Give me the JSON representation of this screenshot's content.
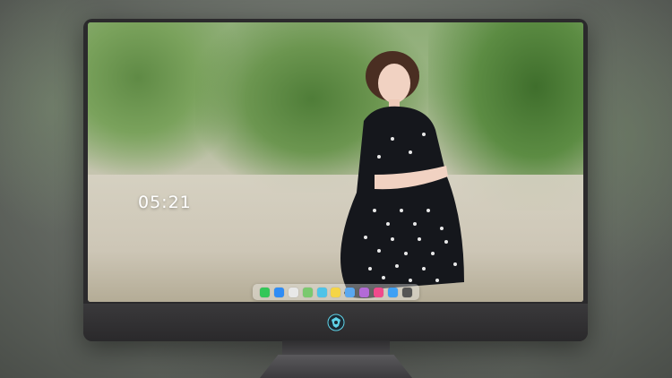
{
  "desktop": {
    "clock": "05:21",
    "wallpaper": "wallpaper-photo"
  },
  "dock": {
    "apps": [
      {
        "name": "messages-icon",
        "color": "#34c759"
      },
      {
        "name": "mail-icon",
        "color": "#2f8cf5"
      },
      {
        "name": "safari-icon",
        "color": "#e8e8e8"
      },
      {
        "name": "maps-icon",
        "color": "#7bc96f"
      },
      {
        "name": "photos-icon",
        "color": "#4fc3e8"
      },
      {
        "name": "notes-icon",
        "color": "#f5d547"
      },
      {
        "name": "finder-icon",
        "color": "#5aa8f0"
      },
      {
        "name": "pencil-icon",
        "color": "#b36ad6"
      },
      {
        "name": "music-icon",
        "color": "#f04a8c"
      },
      {
        "name": "app-store-icon",
        "color": "#3ea0f4"
      },
      {
        "name": "camera-icon",
        "color": "#555555"
      }
    ]
  },
  "colors": {
    "bezel": "#2b2a2c",
    "accent_logo": "#5fd3e8"
  }
}
